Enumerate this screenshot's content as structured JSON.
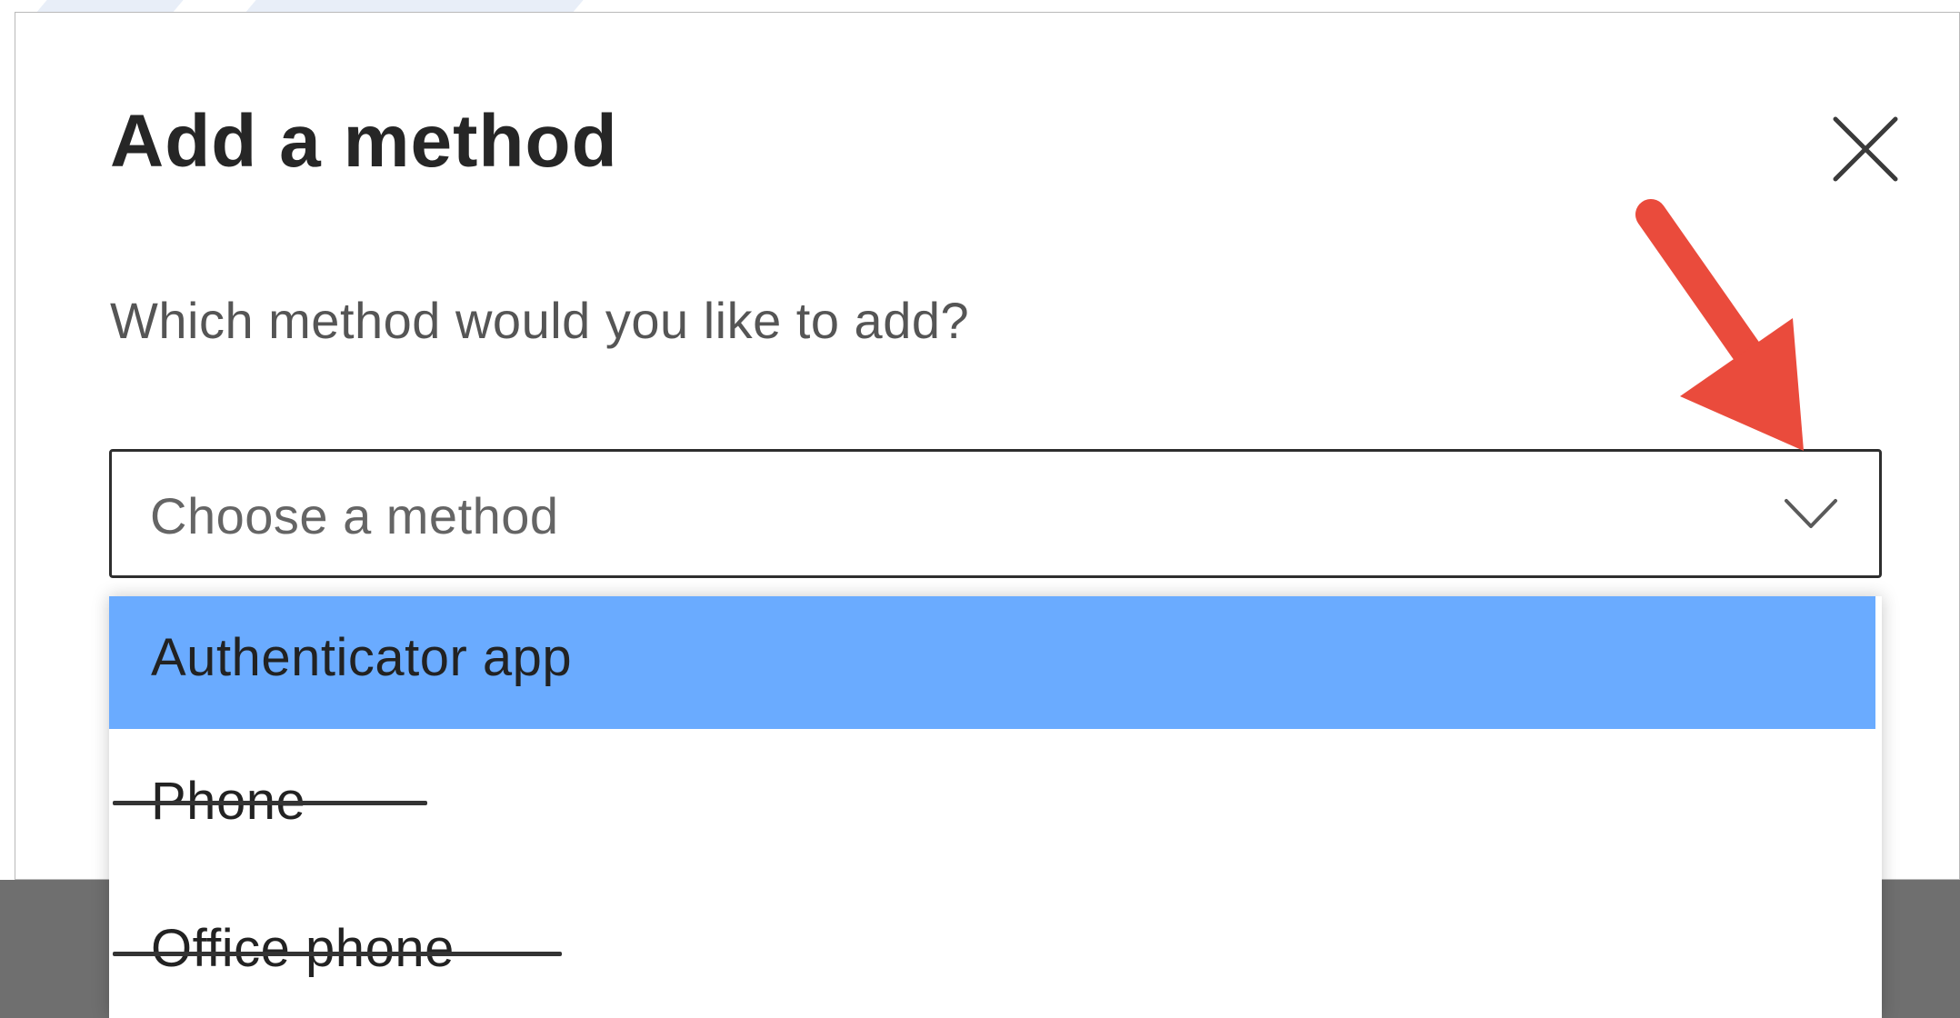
{
  "dialog": {
    "title": "Add a method",
    "close_icon": "close-icon",
    "question": "Which method would you like to add?",
    "select": {
      "placeholder": "Choose a method",
      "icon": "chevron-down-icon"
    },
    "options": [
      {
        "label": "Authenticator app",
        "selected": true,
        "struck_through": false
      },
      {
        "label": "Phone",
        "selected": false,
        "struck_through": true
      },
      {
        "label": "Office phone",
        "selected": false,
        "struck_through": true
      }
    ]
  },
  "annotation": {
    "icon": "red-arrow-icon",
    "color": "#ea4b3c"
  },
  "colors": {
    "selected_option": "#6aabff",
    "title_text": "#262626",
    "footer_band": "#6f6f6f"
  }
}
